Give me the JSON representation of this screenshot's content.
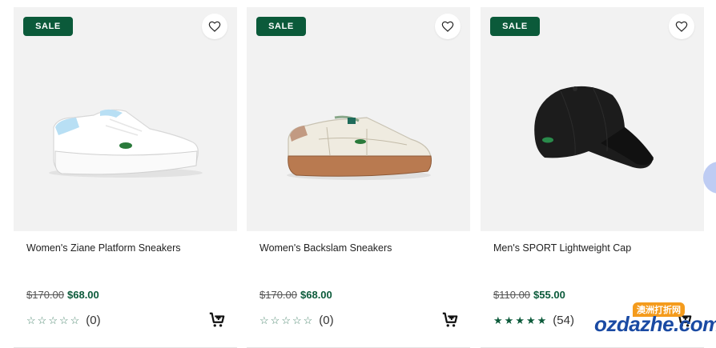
{
  "colors": {
    "accent": "#0b5a3a",
    "card_bg": "#f2f2f2",
    "star": "#0b5a3a"
  },
  "products": [
    {
      "badge": "SALE",
      "name": "Women's Ziane Platform Sneakers",
      "old_price": "$170.00",
      "price": "$68.00",
      "rating_stars": 0,
      "review_count": "(0)",
      "image": "white-platform-sneaker"
    },
    {
      "badge": "SALE",
      "name": "Women's Backslam Sneakers",
      "old_price": "$170.00",
      "price": "$68.00",
      "rating_stars": 0,
      "review_count": "(0)",
      "image": "cream-gum-sole-sneaker"
    },
    {
      "badge": "SALE",
      "name": "Men's SPORT Lightweight Cap",
      "old_price": "$110.00",
      "price": "$55.00",
      "rating_stars": 5,
      "review_count": "(54)",
      "image": "black-cap"
    }
  ],
  "watermark": {
    "badge": "澳洲打折网",
    "text": "ozdazhe.com"
  }
}
